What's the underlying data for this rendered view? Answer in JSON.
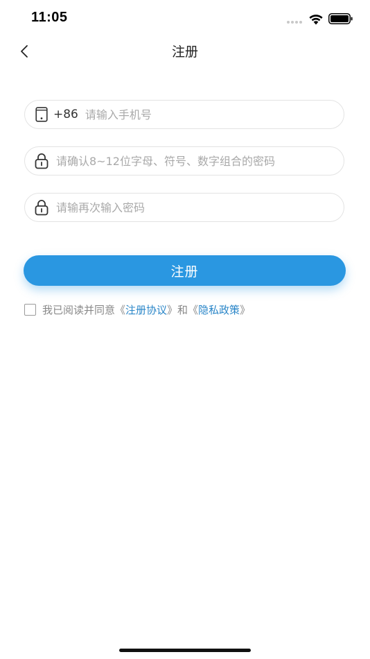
{
  "status_bar": {
    "time": "11:05"
  },
  "nav": {
    "title": "注册"
  },
  "form": {
    "phone": {
      "country_code": "+86",
      "placeholder": "请输入手机号",
      "value": ""
    },
    "password": {
      "placeholder": "请确认8~12位字母、符号、数字组合的密码",
      "value": ""
    },
    "password_confirm": {
      "placeholder": "请输再次输入密码",
      "value": ""
    },
    "submit_label": "注册"
  },
  "agreement": {
    "checked": false,
    "prefix": "我已阅读并同意《",
    "terms_link": "注册协议",
    "middle": "》和《",
    "privacy_link": "隐私政策",
    "suffix": "》"
  },
  "colors": {
    "accent": "#2a97e1",
    "link": "#2a86c8",
    "placeholder": "#a9a9a9",
    "field_border": "#e3e3e3"
  }
}
